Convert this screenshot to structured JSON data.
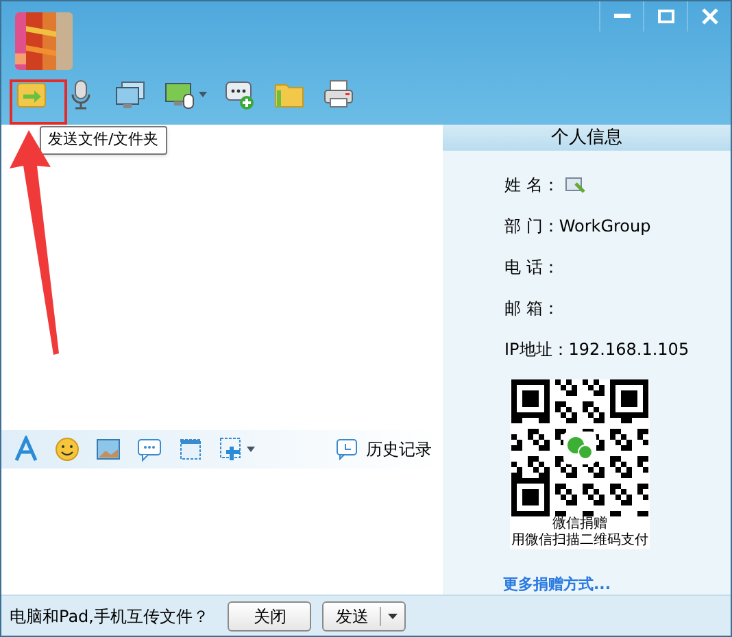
{
  "tooltip": "发送文件/文件夹",
  "info_panel": {
    "title": "个人信息",
    "fields": [
      {
        "label": "姓 名：",
        "editable": true
      },
      {
        "label": "部 门：",
        "value": "WorkGroup",
        "editable": false
      },
      {
        "label": "电 话：",
        "editable": false
      },
      {
        "label": "邮 箱：",
        "editable": false
      },
      {
        "label": "IP地址：",
        "value": "192.168.1.105",
        "editable": false
      }
    ],
    "qr_caption": [
      "微信捐赠",
      "用微信扫描二维码支付"
    ],
    "more_link": "更多捐赠方式..."
  },
  "history": "历史记录",
  "bottom": {
    "prompt": "电脑和Pad,手机互传文件？",
    "close": "关闭",
    "send": "发送"
  }
}
